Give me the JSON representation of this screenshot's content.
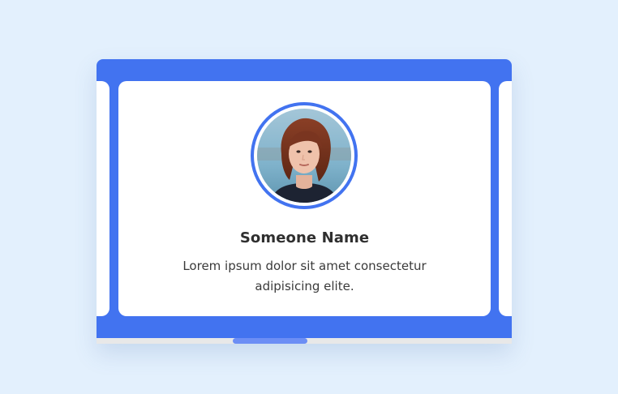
{
  "card": {
    "name": "Someone Name",
    "text": "Lorem ipsum dolor sit amet consectetur adipisicing elite."
  },
  "icons": {
    "avatar": "person-photo"
  },
  "colors": {
    "background": "#e3f0fd",
    "accent": "#4273f0",
    "scrollbar_thumb": "#6c8ef5",
    "card": "#ffffff",
    "name": "#2f2f2f",
    "text": "#3a3a3a"
  }
}
